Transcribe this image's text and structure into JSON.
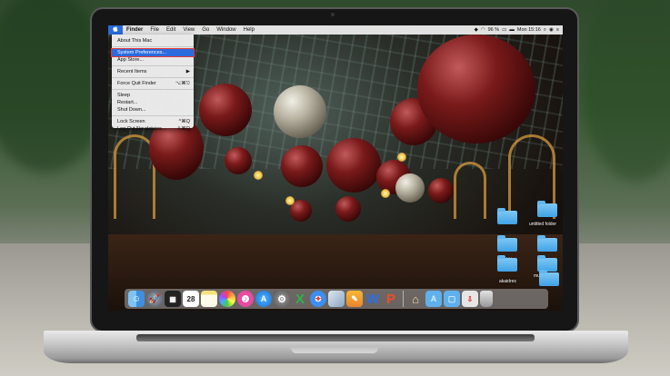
{
  "menubar": {
    "apple_logo": "",
    "app_name": "Finder",
    "menus": [
      "File",
      "Edit",
      "View",
      "Go",
      "Window",
      "Help"
    ],
    "status": {
      "battery": "96 %",
      "clock": "Mon 15:16"
    },
    "status_icons": [
      "dropbox-icon",
      "wifi-icon",
      "battery-icon",
      "flag-icon",
      "search-icon",
      "siri-icon",
      "list-icon"
    ]
  },
  "apple_menu": {
    "items": [
      {
        "label": "About This Mac",
        "shortcut": ""
      },
      {
        "label": "System Preferences...",
        "shortcut": "",
        "selected": true
      },
      {
        "label": "App Store...",
        "shortcut": ""
      },
      {
        "label": "Recent Items",
        "shortcut": "▶"
      },
      {
        "label": "Force Quit Finder",
        "shortcut": "⌥⌘⎋"
      },
      {
        "label": "Sleep",
        "shortcut": ""
      },
      {
        "label": "Restart...",
        "shortcut": ""
      },
      {
        "label": "Shut Down...",
        "shortcut": ""
      },
      {
        "label": "Lock Screen",
        "shortcut": "^⌘Q"
      },
      {
        "label": "Log Out Naudotojas...",
        "shortcut": "⇧⌘Q"
      }
    ]
  },
  "desktop_icons": [
    {
      "label": ""
    },
    {
      "label": "untitled folder"
    },
    {
      "label": "flashki"
    },
    {
      "label": ""
    },
    {
      "label": "muzikos"
    },
    {
      "label": "akaidres"
    },
    {
      "label": ""
    }
  ],
  "dock": {
    "apps": [
      "finder-icon",
      "launchpad-icon",
      "mission-control-icon",
      "calendar-icon",
      "notes-icon",
      "photos-icon",
      "itunes-icon",
      "app-store-icon",
      "system-preferences-icon",
      "excel-icon",
      "safari-icon",
      "preview-icon",
      "pages-icon",
      "word-icon",
      "powerpoint-icon"
    ],
    "calendar_day": "28",
    "right": [
      "home-icon",
      "applications-folder-icon",
      "documents-folder-icon",
      "downloads-icon",
      "trash-icon"
    ]
  }
}
